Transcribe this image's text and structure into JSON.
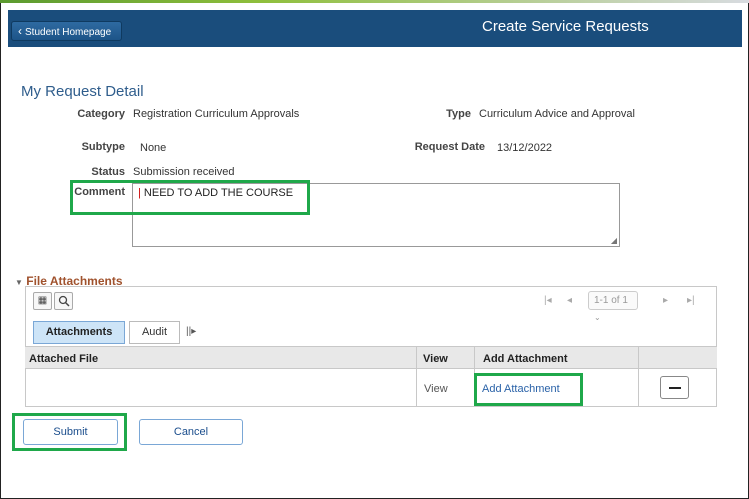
{
  "header": {
    "back_label": "Student Homepage",
    "title": "Create Service Requests",
    "header_color": "#1a4d7c"
  },
  "detail": {
    "section_title": "My Request Detail",
    "category_label": "Category",
    "category_value": "Registration Curriculum Approvals",
    "type_label": "Type",
    "type_value": "Curriculum Advice and Approval",
    "subtype_label": "Subtype",
    "subtype_value": "None",
    "request_date_label": "Request Date",
    "request_date_value": "13/12/2022",
    "status_label": "Status",
    "status_value": "Submission received",
    "comment_label": "Comment",
    "comment_value": "NEED TO ADD THE COURSE"
  },
  "attachments": {
    "section_title": "File Attachments",
    "pager_text": "1-1 of 1",
    "tabs": [
      {
        "label": "Attachments",
        "active": true
      },
      {
        "label": "Audit",
        "active": false
      }
    ],
    "columns": [
      "Attached File",
      "View",
      "Add Attachment"
    ],
    "rows": [
      {
        "attached_file": "",
        "view": "View",
        "add_attachment": "Add Attachment"
      }
    ]
  },
  "actions": {
    "submit_label": "Submit",
    "cancel_label": "Cancel"
  },
  "highlight_color": "#1fa84a",
  "icons": {
    "back": "chevron-left-icon",
    "collapse": "triangle-down-icon",
    "personalize": "grid-settings-icon",
    "find": "search-icon",
    "first": "first-page-icon",
    "prev": "previous-page-icon",
    "next": "next-page-icon",
    "last": "last-page-icon",
    "show_all_columns": "show-columns-icon",
    "delete_row": "minus-icon"
  }
}
